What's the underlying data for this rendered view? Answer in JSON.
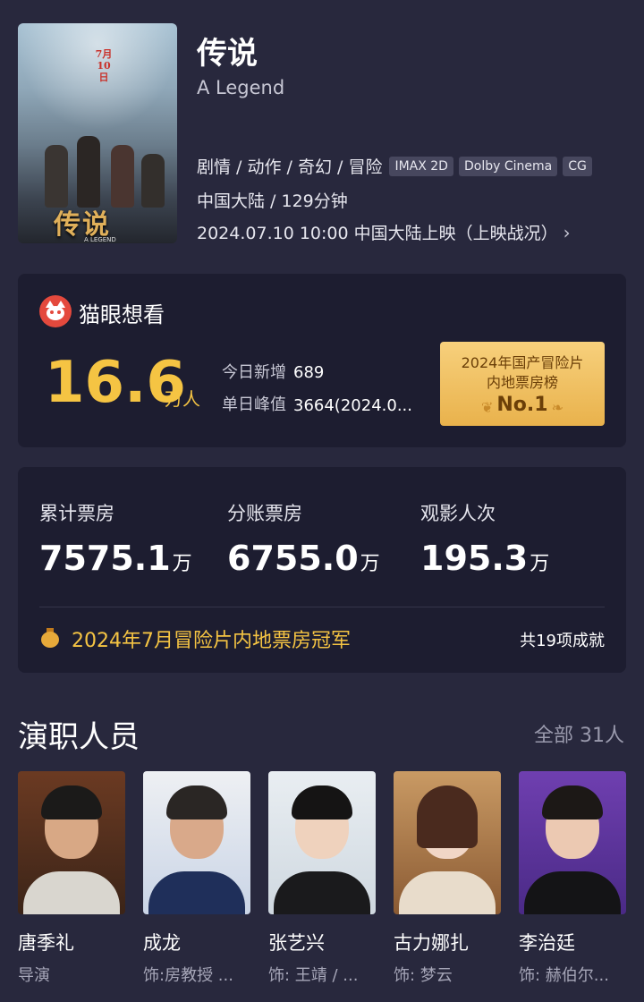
{
  "movie": {
    "poster_text": "传说",
    "poster_subtitle": "A LEGEND",
    "poster_date": "7月10日",
    "title": "传说",
    "english_title": "A Legend",
    "genres": "剧情 / 动作 / 奇幻 / 冒险",
    "formats": [
      "IMAX 2D",
      "Dolby Cinema",
      "CG"
    ],
    "region_duration": "中国大陆 / 129分钟",
    "release": "2024.07.10 10:00 中国大陆上映（上映战况）",
    "chevron_icon": "chevron-right-icon"
  },
  "want": {
    "label": "猫眼想看",
    "count": "16.6",
    "unit": "万人",
    "today_label": "今日新增",
    "today_value": "689",
    "peak_label": "单日峰值",
    "peak_value": "3664(2024.0...",
    "rank_line1": "2024年国产冒险片",
    "rank_line2": "内地票房榜",
    "rank_no": "No.1",
    "accent": "#f5c443",
    "logo_color": "#e4493d"
  },
  "box_office": {
    "items": [
      {
        "label": "累计票房",
        "value": "7575.1",
        "unit": "万"
      },
      {
        "label": "分账票房",
        "value": "6755.0",
        "unit": "万"
      },
      {
        "label": "观影人次",
        "value": "195.3",
        "unit": "万"
      }
    ],
    "achievement": "2024年7月冒险片内地票房冠军",
    "achievement_count": "共19项成就",
    "achievement_icon": "medal-icon"
  },
  "cast": {
    "title": "演职人员",
    "all": "全部 31人",
    "people": [
      {
        "name": "唐季礼",
        "role": "导演"
      },
      {
        "name": "成龙",
        "role": "饰:房教授 ..."
      },
      {
        "name": "张艺兴",
        "role": "饰: 王靖 / ..."
      },
      {
        "name": "古力娜扎",
        "role": "饰: 梦云"
      },
      {
        "name": "李治廷",
        "role": "饰: 赫伯尔..."
      }
    ]
  },
  "colors": {
    "background": "#28283d",
    "card": "#1d1d30",
    "rank_gold": "#e9b24c"
  }
}
